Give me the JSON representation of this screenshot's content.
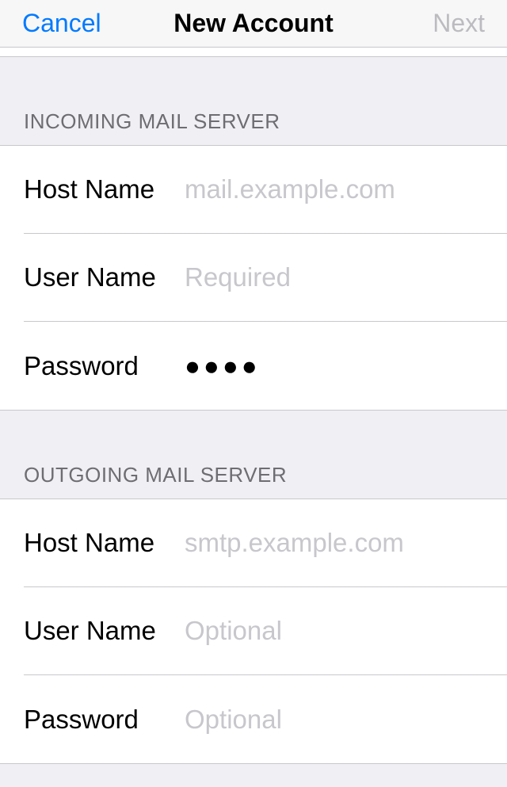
{
  "navbar": {
    "cancel": "Cancel",
    "title": "New Account",
    "next": "Next"
  },
  "incoming": {
    "header": "INCOMING MAIL SERVER",
    "hostLabel": "Host Name",
    "hostPlaceholder": "mail.example.com",
    "hostValue": "",
    "userLabel": "User Name",
    "userPlaceholder": "Required",
    "userValue": "",
    "passLabel": "Password",
    "passValue": "●●●●"
  },
  "outgoing": {
    "header": "OUTGOING MAIL SERVER",
    "hostLabel": "Host Name",
    "hostPlaceholder": "smtp.example.com",
    "hostValue": "",
    "userLabel": "User Name",
    "userPlaceholder": "Optional",
    "userValue": "",
    "passLabel": "Password",
    "passPlaceholder": "Optional",
    "passValue": ""
  }
}
